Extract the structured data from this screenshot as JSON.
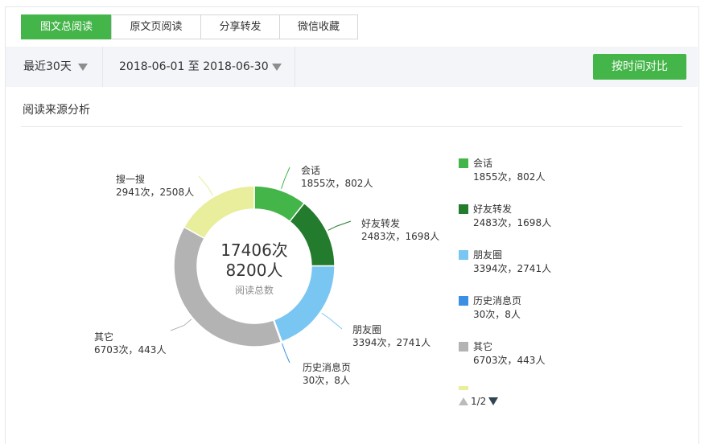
{
  "tabs": [
    {
      "label": "图文总阅读",
      "active": true
    },
    {
      "label": "原文页阅读",
      "active": false
    },
    {
      "label": "分享转发",
      "active": false
    },
    {
      "label": "微信收藏",
      "active": false
    }
  ],
  "filter": {
    "period": "最近30天",
    "date_range": "2018-06-01 至 2018-06-30",
    "compare_button": "按时间对比"
  },
  "section_title": "阅读来源分析",
  "chart_data": {
    "type": "pie",
    "donut": true,
    "center": {
      "total_reads": "17406次",
      "total_users": "8200人",
      "caption": "阅读总数"
    },
    "slices": [
      {
        "name": "会话",
        "reads": 1855,
        "users": 802,
        "label": "1855次，802人",
        "color": "#44b549"
      },
      {
        "name": "好友转发",
        "reads": 2483,
        "users": 1698,
        "label": "2483次，1698人",
        "color": "#237b2d"
      },
      {
        "name": "朋友圈",
        "reads": 3394,
        "users": 2741,
        "label": "3394次，2741人",
        "color": "#7ac6f2"
      },
      {
        "name": "历史消息页",
        "reads": 30,
        "users": 8,
        "label": "30次，8人",
        "color": "#3d8fe3"
      },
      {
        "name": "其它",
        "reads": 6703,
        "users": 443,
        "label": "6703次，443人",
        "color": "#b3b3b3"
      },
      {
        "name": "搜一搜",
        "reads": 2941,
        "users": 2508,
        "label": "2941次，2508人",
        "color": "#e8ee9b"
      }
    ]
  },
  "legend": {
    "items": [
      {
        "name": "会话",
        "value": "1855次，802人",
        "color": "#44b549"
      },
      {
        "name": "好友转发",
        "value": "2483次，1698人",
        "color": "#237b2d"
      },
      {
        "name": "朋友圈",
        "value": "3394次，2741人",
        "color": "#7ac6f2"
      },
      {
        "name": "历史消息页",
        "value": "30次，8人",
        "color": "#3d8fe3"
      },
      {
        "name": "其它",
        "value": "6703次，443人",
        "color": "#b3b3b3"
      }
    ],
    "partial_item_color": "#e8ee9b",
    "pager": "1/2"
  },
  "colors": {
    "brand_green": "#44b549",
    "border": "#d3d6d9",
    "filter_bg": "#f4f5f9"
  }
}
